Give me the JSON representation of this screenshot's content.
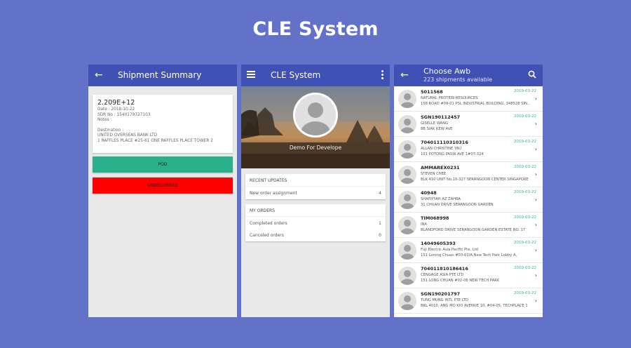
{
  "page": {
    "title": "CLE System"
  },
  "colors": {
    "background": "#6272c8",
    "appbar": "#3f51b5",
    "pod": "#2bb08c",
    "undelivered": "#ff0000",
    "date": "#27b0a0"
  },
  "screen1": {
    "title": "Shipment Summary",
    "back_icon": "arrow-back-icon",
    "awb": "2.209E+12",
    "date": "Date : 2018-10-22",
    "sdr": "SDR No : 1540179727103",
    "notes": "Notes :",
    "destination_label": "Destination :",
    "destination_name": "UNITED OVERSEAS BANK LTD",
    "destination_address": "1 RAFFLES PLACE #25-61 ONE RAFFLES PLACE TOWER 2",
    "pod_label": "POD",
    "undelivered_label": "UNDELIVERED"
  },
  "screen2": {
    "title": "CLE System",
    "menu_icon": "hamburger-icon",
    "more_icon": "more-vert-icon",
    "user_name": "Demo For Develope",
    "recent": {
      "header": "RECENT UPDATES",
      "rows": [
        {
          "label": "New order assignment",
          "count": "4"
        }
      ]
    },
    "orders": {
      "header": "MY ORDERS",
      "rows": [
        {
          "label": "Completed orders",
          "count": "1"
        },
        {
          "label": "Canceled orders",
          "count": "0"
        }
      ]
    }
  },
  "screen3": {
    "title": "Choose Awb",
    "subtitle": "223 shipments available",
    "search_icon": "search-icon",
    "items": [
      {
        "code": "5011568",
        "date": "2019-03-22",
        "name": "NATURAL PROTEIN RESOURCES",
        "address": "156 ROAD #09-01 PSL INDUSTRIAL BUILDING, 348528 SIN..."
      },
      {
        "code": "SGN190112457",
        "date": "2019-03-22",
        "name": "GISELLE WANG",
        "address": "8B SIAK KEW AVE"
      },
      {
        "code": "704011110310316",
        "date": "2019-03-22",
        "name": "ALLAN CHRISTINE YAU",
        "address": "101 POTONG PASIR AVE 1#07-324"
      },
      {
        "code": "AMMAREX0231",
        "date": "2019-03-22",
        "name": "STEVEN CHEE",
        "address": "BLK 410 UNIT No.10-327 SERANGOON CENTER SINGAPORE"
      },
      {
        "code": "40948",
        "date": "2019-03-22",
        "name": "SHAFIYYAH AZ ZAHRA",
        "address": "31 CHUAN DRIVE SERANGOON GARDEN"
      },
      {
        "code": "TIM068998",
        "date": "2019-03-22",
        "name": "INA",
        "address": "BLANDFORD DRIVE SERANGOON GARDEN ESTATE NO. 17"
      },
      {
        "code": "14049605393",
        "date": "2019-03-22",
        "name": "Fuji Electric Asia Pacific Pte. Ltd",
        "address": "151 Lorong Chuan #03-01/A,New Tech Park Lobby A,"
      },
      {
        "code": "704011810186416",
        "date": "2019-03-22",
        "name": "CENGAGE ASIA PTE LTD",
        "address": "151 LONG CHUAN #02-08 NEW TECH PARK"
      },
      {
        "code": "SGN190201797",
        "date": "2019-03-22",
        "name": "TUNG MUNG INTL PTE LTD",
        "address": "BKL 4010, ANG MO KIO AVENUE 10, #04-05, TECHPLACE 1"
      }
    ]
  }
}
